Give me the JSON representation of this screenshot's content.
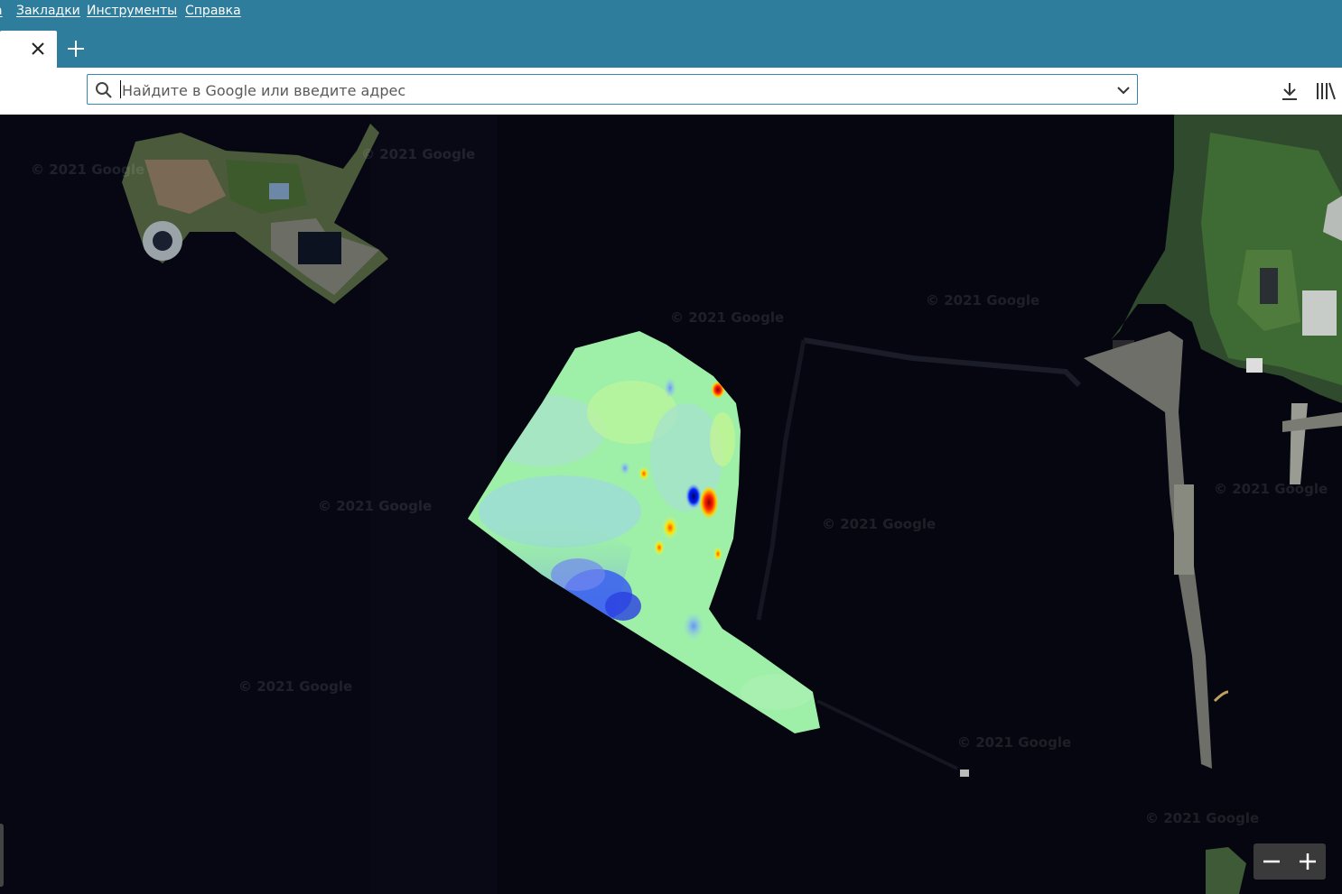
{
  "menu": {
    "items": [
      {
        "id": "partial",
        "label": "а"
      },
      {
        "id": "bookmarks",
        "label": "Закладки"
      },
      {
        "id": "tools",
        "label": "Инструменты"
      },
      {
        "id": "help",
        "label": "Справка"
      }
    ]
  },
  "urlbar": {
    "placeholder": "Найдите в Google или введите адрес",
    "value": ""
  },
  "map": {
    "watermark": "© 2021 Google",
    "zoom_out_icon": "minus-icon",
    "zoom_in_icon": "plus-icon"
  },
  "colors": {
    "chrome": "#2e7d9d",
    "urlbar_border": "#3a86b0",
    "water": "#05060f",
    "overlay_base": "#9ef0a8"
  },
  "icons": [
    "close-icon",
    "plus-icon",
    "search-icon",
    "chevron-down-icon",
    "download-icon",
    "library-icon",
    "minus-icon"
  ]
}
